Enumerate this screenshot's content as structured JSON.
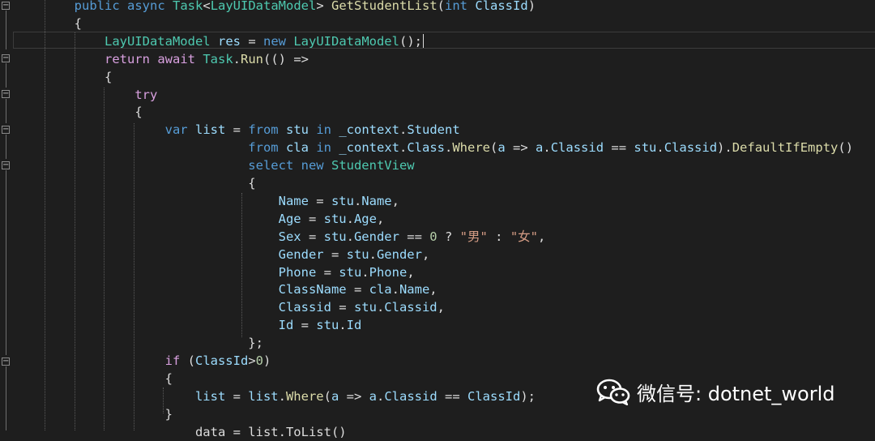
{
  "editor": {
    "lines": [
      {
        "indent": "        ",
        "tokens": [
          {
            "t": "public",
            "c": "kw"
          },
          {
            "t": " ",
            "c": "plain"
          },
          {
            "t": "async",
            "c": "kw"
          },
          {
            "t": " ",
            "c": "plain"
          },
          {
            "t": "Task",
            "c": "type"
          },
          {
            "t": "<",
            "c": "plain"
          },
          {
            "t": "LayUIDataModel",
            "c": "type"
          },
          {
            "t": "> ",
            "c": "plain"
          },
          {
            "t": "GetStudentList",
            "c": "method"
          },
          {
            "t": "(",
            "c": "plain"
          },
          {
            "t": "int",
            "c": "kw"
          },
          {
            "t": " ",
            "c": "plain"
          },
          {
            "t": "ClassId",
            "c": "var"
          },
          {
            "t": ")",
            "c": "plain"
          }
        ]
      },
      {
        "indent": "        ",
        "tokens": [
          {
            "t": "{",
            "c": "plain"
          }
        ]
      },
      {
        "indent": "            ",
        "tokens": [
          {
            "t": "LayUIDataModel",
            "c": "type"
          },
          {
            "t": " ",
            "c": "plain"
          },
          {
            "t": "res",
            "c": "var"
          },
          {
            "t": " = ",
            "c": "plain"
          },
          {
            "t": "new",
            "c": "kw"
          },
          {
            "t": " ",
            "c": "plain"
          },
          {
            "t": "LayUIDataModel",
            "c": "type"
          },
          {
            "t": "();",
            "c": "plain"
          }
        ],
        "caret": true
      },
      {
        "indent": "            ",
        "tokens": [
          {
            "t": "return",
            "c": "kw2"
          },
          {
            "t": " ",
            "c": "plain"
          },
          {
            "t": "await",
            "c": "kw2"
          },
          {
            "t": " ",
            "c": "plain"
          },
          {
            "t": "Task",
            "c": "type"
          },
          {
            "t": ".",
            "c": "plain"
          },
          {
            "t": "Run",
            "c": "method"
          },
          {
            "t": "(() =>",
            "c": "plain"
          }
        ]
      },
      {
        "indent": "            ",
        "tokens": [
          {
            "t": "{",
            "c": "plain"
          }
        ]
      },
      {
        "indent": "                ",
        "tokens": [
          {
            "t": "try",
            "c": "kw2"
          }
        ]
      },
      {
        "indent": "                ",
        "tokens": [
          {
            "t": "{",
            "c": "plain"
          }
        ]
      },
      {
        "indent": "                    ",
        "tokens": [
          {
            "t": "var",
            "c": "kw"
          },
          {
            "t": " ",
            "c": "plain"
          },
          {
            "t": "list",
            "c": "var"
          },
          {
            "t": " = ",
            "c": "plain"
          },
          {
            "t": "from",
            "c": "kw"
          },
          {
            "t": " ",
            "c": "plain"
          },
          {
            "t": "stu",
            "c": "var"
          },
          {
            "t": " ",
            "c": "plain"
          },
          {
            "t": "in",
            "c": "kw"
          },
          {
            "t": " ",
            "c": "plain"
          },
          {
            "t": "_context",
            "c": "var"
          },
          {
            "t": ".",
            "c": "plain"
          },
          {
            "t": "Student",
            "c": "var"
          }
        ]
      },
      {
        "indent": "                               ",
        "tokens": [
          {
            "t": "from",
            "c": "kw"
          },
          {
            "t": " ",
            "c": "plain"
          },
          {
            "t": "cla",
            "c": "var"
          },
          {
            "t": " ",
            "c": "plain"
          },
          {
            "t": "in",
            "c": "kw"
          },
          {
            "t": " ",
            "c": "plain"
          },
          {
            "t": "_context",
            "c": "var"
          },
          {
            "t": ".",
            "c": "plain"
          },
          {
            "t": "Class",
            "c": "var"
          },
          {
            "t": ".",
            "c": "plain"
          },
          {
            "t": "Where",
            "c": "method"
          },
          {
            "t": "(",
            "c": "plain"
          },
          {
            "t": "a",
            "c": "var"
          },
          {
            "t": " => ",
            "c": "plain"
          },
          {
            "t": "a",
            "c": "var"
          },
          {
            "t": ".",
            "c": "plain"
          },
          {
            "t": "Classid",
            "c": "var"
          },
          {
            "t": " == ",
            "c": "plain"
          },
          {
            "t": "stu",
            "c": "var"
          },
          {
            "t": ".",
            "c": "plain"
          },
          {
            "t": "Classid",
            "c": "var"
          },
          {
            "t": ").",
            "c": "plain"
          },
          {
            "t": "DefaultIfEmpty",
            "c": "method"
          },
          {
            "t": "()",
            "c": "plain"
          }
        ]
      },
      {
        "indent": "                               ",
        "tokens": [
          {
            "t": "select",
            "c": "kw"
          },
          {
            "t": " ",
            "c": "plain"
          },
          {
            "t": "new",
            "c": "kw"
          },
          {
            "t": " ",
            "c": "plain"
          },
          {
            "t": "StudentView",
            "c": "type"
          }
        ]
      },
      {
        "indent": "                               ",
        "tokens": [
          {
            "t": "{",
            "c": "plain"
          }
        ]
      },
      {
        "indent": "                                   ",
        "tokens": [
          {
            "t": "Name",
            "c": "var"
          },
          {
            "t": " = ",
            "c": "plain"
          },
          {
            "t": "stu",
            "c": "var"
          },
          {
            "t": ".",
            "c": "plain"
          },
          {
            "t": "Name",
            "c": "var"
          },
          {
            "t": ",",
            "c": "plain"
          }
        ]
      },
      {
        "indent": "                                   ",
        "tokens": [
          {
            "t": "Age",
            "c": "var"
          },
          {
            "t": " = ",
            "c": "plain"
          },
          {
            "t": "stu",
            "c": "var"
          },
          {
            "t": ".",
            "c": "plain"
          },
          {
            "t": "Age",
            "c": "var"
          },
          {
            "t": ",",
            "c": "plain"
          }
        ]
      },
      {
        "indent": "                                   ",
        "tokens": [
          {
            "t": "Sex",
            "c": "var"
          },
          {
            "t": " = ",
            "c": "plain"
          },
          {
            "t": "stu",
            "c": "var"
          },
          {
            "t": ".",
            "c": "plain"
          },
          {
            "t": "Gender",
            "c": "var"
          },
          {
            "t": " == ",
            "c": "plain"
          },
          {
            "t": "0",
            "c": "num"
          },
          {
            "t": " ? ",
            "c": "plain"
          },
          {
            "t": "\"男\"",
            "c": "str"
          },
          {
            "t": " : ",
            "c": "plain"
          },
          {
            "t": "\"女\"",
            "c": "str"
          },
          {
            "t": ",",
            "c": "plain"
          }
        ]
      },
      {
        "indent": "                                   ",
        "tokens": [
          {
            "t": "Gender",
            "c": "var"
          },
          {
            "t": " = ",
            "c": "plain"
          },
          {
            "t": "stu",
            "c": "var"
          },
          {
            "t": ".",
            "c": "plain"
          },
          {
            "t": "Gender",
            "c": "var"
          },
          {
            "t": ",",
            "c": "plain"
          }
        ]
      },
      {
        "indent": "                                   ",
        "tokens": [
          {
            "t": "Phone",
            "c": "var"
          },
          {
            "t": " = ",
            "c": "plain"
          },
          {
            "t": "stu",
            "c": "var"
          },
          {
            "t": ".",
            "c": "plain"
          },
          {
            "t": "Phone",
            "c": "var"
          },
          {
            "t": ",",
            "c": "plain"
          }
        ]
      },
      {
        "indent": "                                   ",
        "tokens": [
          {
            "t": "ClassName",
            "c": "var"
          },
          {
            "t": " = ",
            "c": "plain"
          },
          {
            "t": "cla",
            "c": "var"
          },
          {
            "t": ".",
            "c": "plain"
          },
          {
            "t": "Name",
            "c": "var"
          },
          {
            "t": ",",
            "c": "plain"
          }
        ]
      },
      {
        "indent": "                                   ",
        "tokens": [
          {
            "t": "Classid",
            "c": "var"
          },
          {
            "t": " = ",
            "c": "plain"
          },
          {
            "t": "stu",
            "c": "var"
          },
          {
            "t": ".",
            "c": "plain"
          },
          {
            "t": "Classid",
            "c": "var"
          },
          {
            "t": ",",
            "c": "plain"
          }
        ]
      },
      {
        "indent": "                                   ",
        "tokens": [
          {
            "t": "Id",
            "c": "var"
          },
          {
            "t": " = ",
            "c": "plain"
          },
          {
            "t": "stu",
            "c": "var"
          },
          {
            "t": ".",
            "c": "plain"
          },
          {
            "t": "Id",
            "c": "var"
          }
        ]
      },
      {
        "indent": "                               ",
        "tokens": [
          {
            "t": "};",
            "c": "plain"
          }
        ]
      },
      {
        "indent": "                    ",
        "tokens": [
          {
            "t": "if",
            "c": "kw2"
          },
          {
            "t": " (",
            "c": "plain"
          },
          {
            "t": "ClassId",
            "c": "var"
          },
          {
            "t": ">",
            "c": "plain"
          },
          {
            "t": "0",
            "c": "num"
          },
          {
            "t": ")",
            "c": "plain"
          }
        ]
      },
      {
        "indent": "                    ",
        "tokens": [
          {
            "t": "{",
            "c": "plain"
          }
        ]
      },
      {
        "indent": "                        ",
        "tokens": [
          {
            "t": "list",
            "c": "var"
          },
          {
            "t": " = ",
            "c": "plain"
          },
          {
            "t": "list",
            "c": "var"
          },
          {
            "t": ".",
            "c": "plain"
          },
          {
            "t": "Where",
            "c": "method"
          },
          {
            "t": "(",
            "c": "plain"
          },
          {
            "t": "a",
            "c": "var"
          },
          {
            "t": " => ",
            "c": "plain"
          },
          {
            "t": "a",
            "c": "var"
          },
          {
            "t": ".",
            "c": "plain"
          },
          {
            "t": "Classid",
            "c": "var"
          },
          {
            "t": " == ",
            "c": "plain"
          },
          {
            "t": "ClassId",
            "c": "var"
          },
          {
            "t": ");",
            "c": "plain"
          }
        ]
      },
      {
        "indent": "                    ",
        "tokens": [
          {
            "t": "}",
            "c": "plain"
          }
        ]
      },
      {
        "indent": "                    ",
        "tokens": [
          {
            "t": "    data = list.ToList()",
            "c": "plain"
          }
        ]
      }
    ]
  },
  "watermark": {
    "text": "微信号: dotnet_world",
    "icon": "wechat-icon"
  }
}
